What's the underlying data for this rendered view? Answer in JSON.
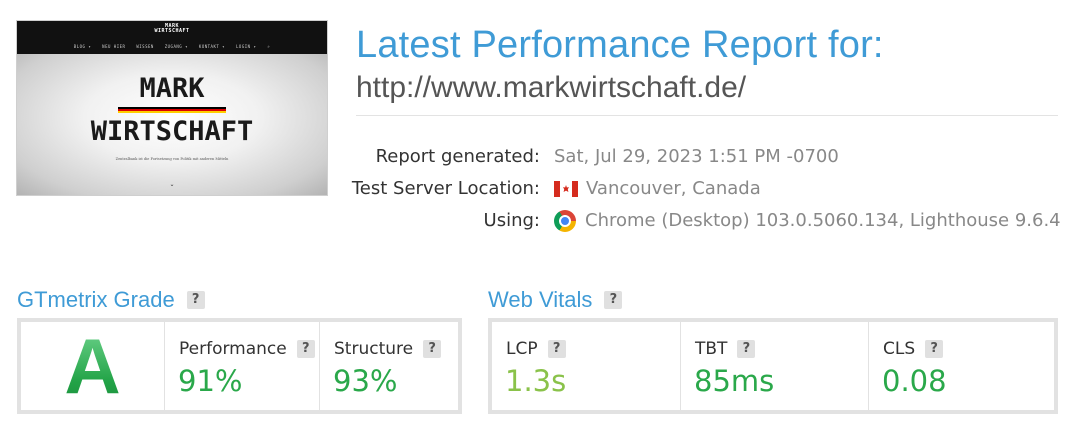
{
  "thumbnail": {
    "brand_line1": "MARK",
    "brand_line2": "WIRTSCHAFT",
    "menu": [
      "BLOG ▾",
      "NEU HIER",
      "WISSEN",
      "ZUGANG ▾",
      "KONTAKT ▾",
      "LOGIN ▾",
      "⌕"
    ],
    "hero_line1": "MARK",
    "hero_line2": "WIRTSCHAFT",
    "tagline": "Zentralbank ist die Fortsetzung von Politik mit anderen Mitteln",
    "flag_colors": [
      "#000000",
      "#dd0000",
      "#ffce00"
    ]
  },
  "header": {
    "title": "Latest Performance Report for:",
    "url": "http://www.markwirtschaft.de/"
  },
  "meta": {
    "generated_label": "Report generated:",
    "generated_value": "Sat, Jul 29, 2023 1:51 PM -0700",
    "location_label": "Test Server Location:",
    "location_value": "Vancouver, Canada",
    "location_icon": "canada-flag-icon",
    "using_label": "Using:",
    "using_value": "Chrome (Desktop) 103.0.5060.134, Lighthouse 9.6.4",
    "using_icon": "chrome-icon"
  },
  "grade": {
    "title": "GTmetrix Grade",
    "letter": "A",
    "performance_label": "Performance",
    "performance_value": "91%",
    "structure_label": "Structure",
    "structure_value": "93%"
  },
  "vitals": {
    "title": "Web Vitals",
    "lcp_label": "LCP",
    "lcp_value": "1.3s",
    "tbt_label": "TBT",
    "tbt_value": "85ms",
    "cls_label": "CLS",
    "cls_value": "0.08"
  },
  "help_text": "?",
  "colors": {
    "accent_blue": "#3f9bd6",
    "good_green": "#2aa84a",
    "light_green": "#8ac24a"
  }
}
